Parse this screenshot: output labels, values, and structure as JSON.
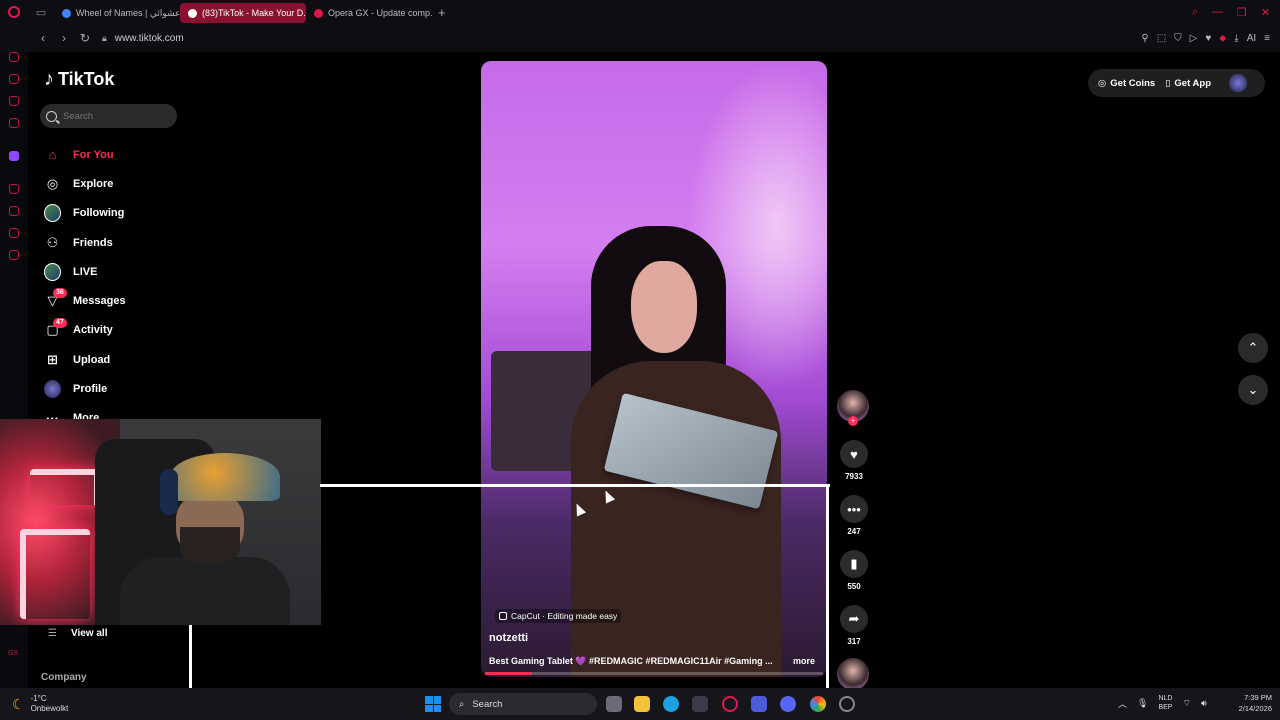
{
  "browser": {
    "tabs": [
      {
        "title": "Wheel of Names | عشوائي...",
        "active": false,
        "color": "#4285f4"
      },
      {
        "title": "(83)TikTok - Make Your D...",
        "active": true,
        "color": "#ffffff"
      },
      {
        "title": "Opera GX - Update comp...",
        "active": false,
        "color": "#e0174a"
      }
    ],
    "url": "www.tiktok.com",
    "ai_label": "AI"
  },
  "tiktok": {
    "logo_text": "TikTok",
    "search_placeholder": "Search",
    "nav": [
      {
        "label": "For You",
        "icon": "home-icon",
        "active": true,
        "badge": ""
      },
      {
        "label": "Explore",
        "icon": "compass-icon",
        "active": false,
        "badge": ""
      },
      {
        "label": "Following",
        "icon": "following-avatar-icon",
        "active": false,
        "badge": ""
      },
      {
        "label": "Friends",
        "icon": "friends-icon",
        "active": false,
        "badge": ""
      },
      {
        "label": "LIVE",
        "icon": "live-icon",
        "active": false,
        "badge": ""
      },
      {
        "label": "Messages",
        "icon": "messages-icon",
        "active": false,
        "badge": "36"
      },
      {
        "label": "Activity",
        "icon": "activity-icon",
        "active": false,
        "badge": "47"
      },
      {
        "label": "Upload",
        "icon": "upload-icon",
        "active": false,
        "badge": ""
      },
      {
        "label": "Profile",
        "icon": "profile-icon",
        "active": false,
        "badge": ""
      },
      {
        "label": "More",
        "icon": "more-icon",
        "active": false,
        "badge": ""
      }
    ],
    "view_all": "View all",
    "company": "Company",
    "get_coins": "Get Coins",
    "get_app": "Get App",
    "video": {
      "capcut": "CapCut · Editing made easy",
      "author": "notzetti",
      "caption": "Best Gaming Tablet 💜 #REDMAGIC #REDMAGIC11Air #Gaming ...",
      "more": "more",
      "progress": 0.14
    },
    "actions": {
      "likes": "7933",
      "comments": "247",
      "saves": "550",
      "shares": "317"
    }
  },
  "taskbar": {
    "temp": "-1°C",
    "weather": "Onbewolkt",
    "search": "Search",
    "lang_top": "NLD",
    "lang_bottom": "BEP",
    "time": "7:39 PM",
    "date": "2/14/2026"
  },
  "colors": {
    "accent": "#fe2c55",
    "opera": "#e0174a"
  }
}
